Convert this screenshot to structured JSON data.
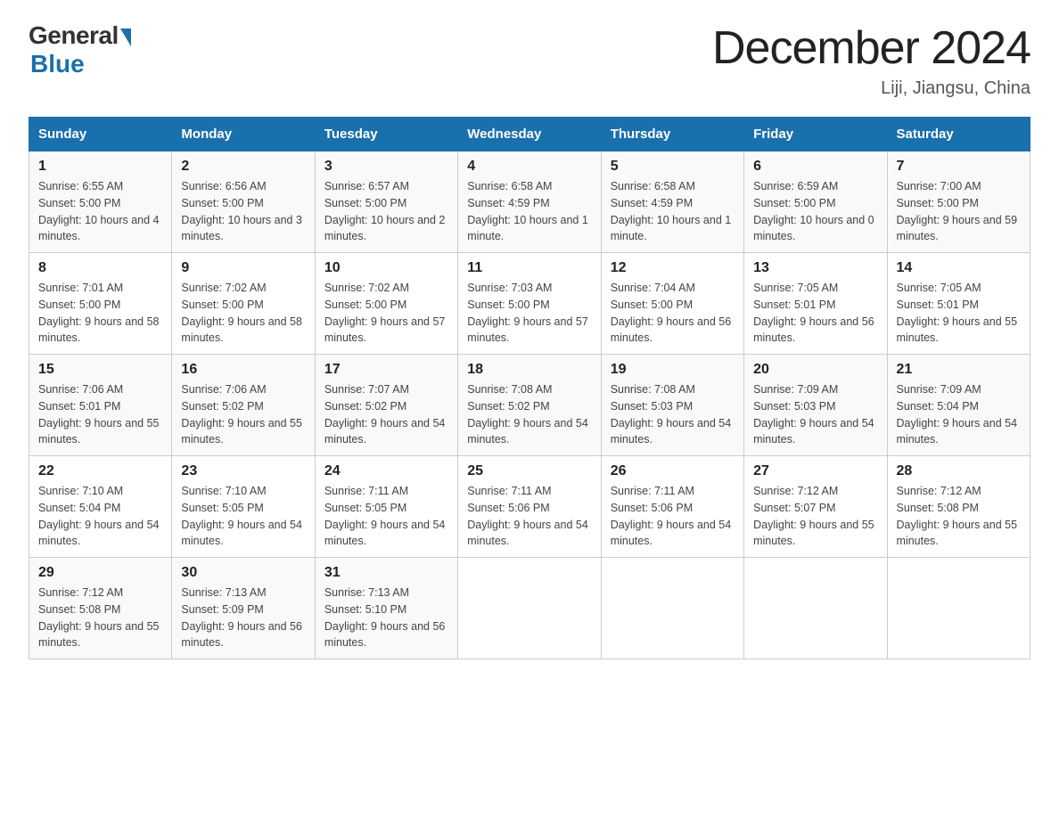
{
  "logo": {
    "general": "General",
    "blue": "Blue"
  },
  "title": "December 2024",
  "subtitle": "Liji, Jiangsu, China",
  "days_of_week": [
    "Sunday",
    "Monday",
    "Tuesday",
    "Wednesday",
    "Thursday",
    "Friday",
    "Saturday"
  ],
  "weeks": [
    [
      {
        "day": "1",
        "sunrise": "6:55 AM",
        "sunset": "5:00 PM",
        "daylight": "10 hours and 4 minutes."
      },
      {
        "day": "2",
        "sunrise": "6:56 AM",
        "sunset": "5:00 PM",
        "daylight": "10 hours and 3 minutes."
      },
      {
        "day": "3",
        "sunrise": "6:57 AM",
        "sunset": "5:00 PM",
        "daylight": "10 hours and 2 minutes."
      },
      {
        "day": "4",
        "sunrise": "6:58 AM",
        "sunset": "4:59 PM",
        "daylight": "10 hours and 1 minute."
      },
      {
        "day": "5",
        "sunrise": "6:58 AM",
        "sunset": "4:59 PM",
        "daylight": "10 hours and 1 minute."
      },
      {
        "day": "6",
        "sunrise": "6:59 AM",
        "sunset": "5:00 PM",
        "daylight": "10 hours and 0 minutes."
      },
      {
        "day": "7",
        "sunrise": "7:00 AM",
        "sunset": "5:00 PM",
        "daylight": "9 hours and 59 minutes."
      }
    ],
    [
      {
        "day": "8",
        "sunrise": "7:01 AM",
        "sunset": "5:00 PM",
        "daylight": "9 hours and 58 minutes."
      },
      {
        "day": "9",
        "sunrise": "7:02 AM",
        "sunset": "5:00 PM",
        "daylight": "9 hours and 58 minutes."
      },
      {
        "day": "10",
        "sunrise": "7:02 AM",
        "sunset": "5:00 PM",
        "daylight": "9 hours and 57 minutes."
      },
      {
        "day": "11",
        "sunrise": "7:03 AM",
        "sunset": "5:00 PM",
        "daylight": "9 hours and 57 minutes."
      },
      {
        "day": "12",
        "sunrise": "7:04 AM",
        "sunset": "5:00 PM",
        "daylight": "9 hours and 56 minutes."
      },
      {
        "day": "13",
        "sunrise": "7:05 AM",
        "sunset": "5:01 PM",
        "daylight": "9 hours and 56 minutes."
      },
      {
        "day": "14",
        "sunrise": "7:05 AM",
        "sunset": "5:01 PM",
        "daylight": "9 hours and 55 minutes."
      }
    ],
    [
      {
        "day": "15",
        "sunrise": "7:06 AM",
        "sunset": "5:01 PM",
        "daylight": "9 hours and 55 minutes."
      },
      {
        "day": "16",
        "sunrise": "7:06 AM",
        "sunset": "5:02 PM",
        "daylight": "9 hours and 55 minutes."
      },
      {
        "day": "17",
        "sunrise": "7:07 AM",
        "sunset": "5:02 PM",
        "daylight": "9 hours and 54 minutes."
      },
      {
        "day": "18",
        "sunrise": "7:08 AM",
        "sunset": "5:02 PM",
        "daylight": "9 hours and 54 minutes."
      },
      {
        "day": "19",
        "sunrise": "7:08 AM",
        "sunset": "5:03 PM",
        "daylight": "9 hours and 54 minutes."
      },
      {
        "day": "20",
        "sunrise": "7:09 AM",
        "sunset": "5:03 PM",
        "daylight": "9 hours and 54 minutes."
      },
      {
        "day": "21",
        "sunrise": "7:09 AM",
        "sunset": "5:04 PM",
        "daylight": "9 hours and 54 minutes."
      }
    ],
    [
      {
        "day": "22",
        "sunrise": "7:10 AM",
        "sunset": "5:04 PM",
        "daylight": "9 hours and 54 minutes."
      },
      {
        "day": "23",
        "sunrise": "7:10 AM",
        "sunset": "5:05 PM",
        "daylight": "9 hours and 54 minutes."
      },
      {
        "day": "24",
        "sunrise": "7:11 AM",
        "sunset": "5:05 PM",
        "daylight": "9 hours and 54 minutes."
      },
      {
        "day": "25",
        "sunrise": "7:11 AM",
        "sunset": "5:06 PM",
        "daylight": "9 hours and 54 minutes."
      },
      {
        "day": "26",
        "sunrise": "7:11 AM",
        "sunset": "5:06 PM",
        "daylight": "9 hours and 54 minutes."
      },
      {
        "day": "27",
        "sunrise": "7:12 AM",
        "sunset": "5:07 PM",
        "daylight": "9 hours and 55 minutes."
      },
      {
        "day": "28",
        "sunrise": "7:12 AM",
        "sunset": "5:08 PM",
        "daylight": "9 hours and 55 minutes."
      }
    ],
    [
      {
        "day": "29",
        "sunrise": "7:12 AM",
        "sunset": "5:08 PM",
        "daylight": "9 hours and 55 minutes."
      },
      {
        "day": "30",
        "sunrise": "7:13 AM",
        "sunset": "5:09 PM",
        "daylight": "9 hours and 56 minutes."
      },
      {
        "day": "31",
        "sunrise": "7:13 AM",
        "sunset": "5:10 PM",
        "daylight": "9 hours and 56 minutes."
      },
      null,
      null,
      null,
      null
    ]
  ],
  "labels": {
    "sunrise": "Sunrise:",
    "sunset": "Sunset:",
    "daylight": "Daylight:"
  }
}
